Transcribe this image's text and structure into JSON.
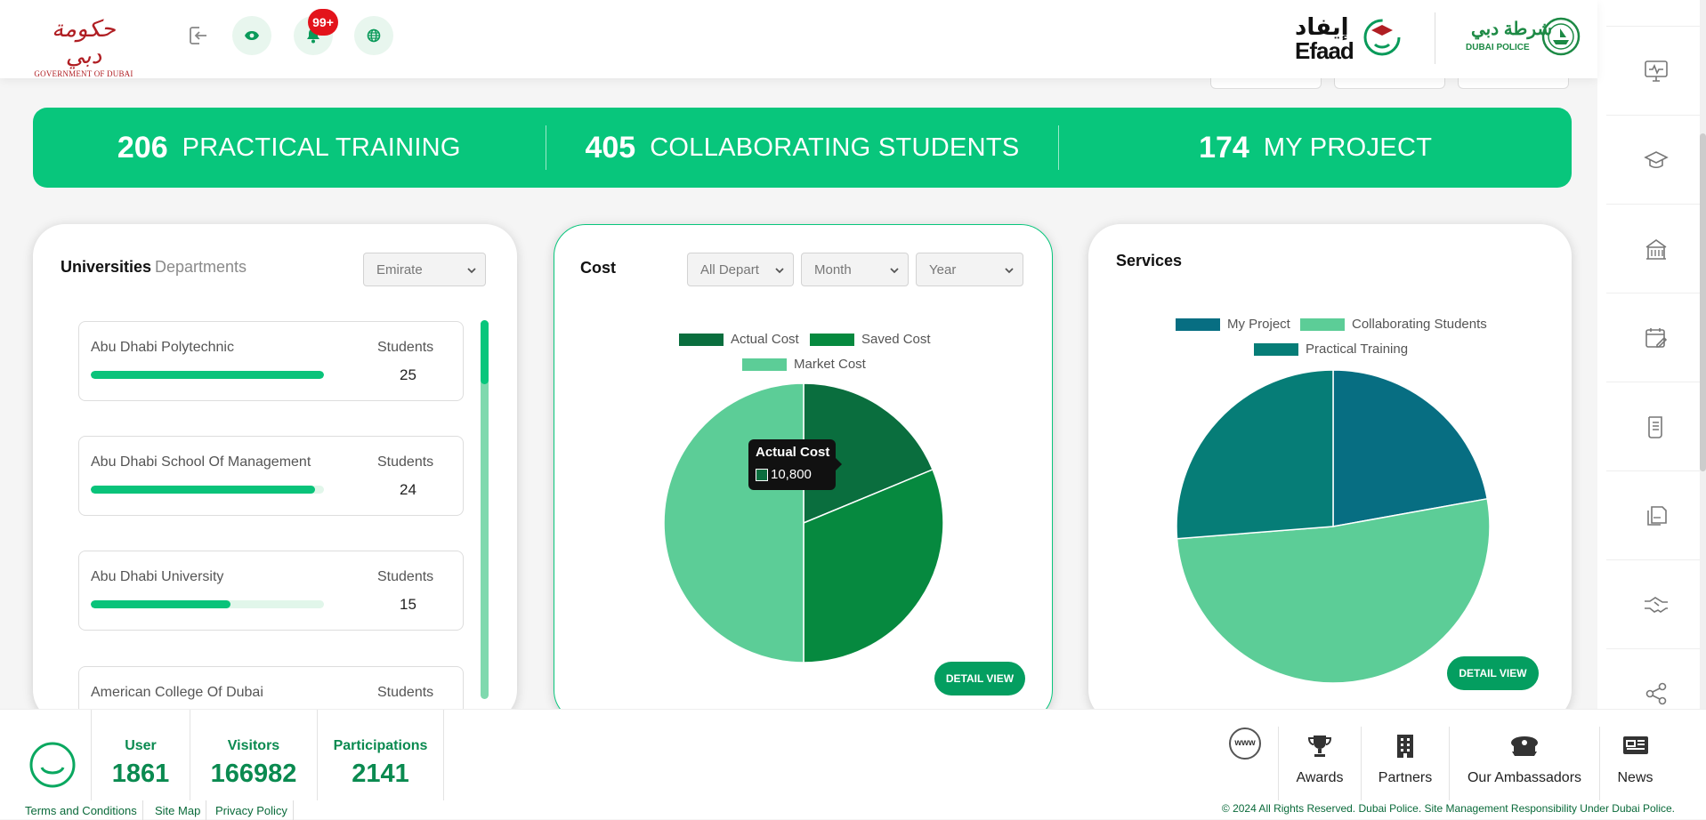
{
  "header": {
    "gov_logo_arabic": "حكومة دبي",
    "gov_logo_text": "GOVERNMENT OF DUBAI",
    "notification_badge": "99+",
    "efaad_arabic": "إيفاد",
    "efaad_text": "Efaad",
    "police_arabic": "شرطة دبي",
    "police_text": "DUBAI POLICE"
  },
  "stats": [
    {
      "value": "206",
      "label": "PRACTICAL TRAINING"
    },
    {
      "value": "405",
      "label": "COLLABORATING STUDENTS"
    },
    {
      "value": "174",
      "label": "MY PROJECT"
    }
  ],
  "universities_card": {
    "tab_active": "Universities",
    "tab_inactive": "Departments",
    "filter_selected": "Emirate",
    "items": [
      {
        "name": "Abu Dhabi Polytechnic",
        "label": "Students",
        "count": "25",
        "progress_pct": 100
      },
      {
        "name": "Abu Dhabi School Of Management",
        "label": "Students",
        "count": "24",
        "progress_pct": 96
      },
      {
        "name": "Abu Dhabi University",
        "label": "Students",
        "count": "15",
        "progress_pct": 60
      },
      {
        "name": "American College Of Dubai",
        "label": "Students",
        "count": "",
        "progress_pct": 0
      }
    ]
  },
  "cost_card": {
    "title": "Cost",
    "filters": [
      "All Depart",
      "Month",
      "Year"
    ],
    "legend": [
      "Actual Cost",
      "Saved Cost",
      "Market Cost"
    ],
    "tooltip_title": "Actual Cost",
    "tooltip_value": "10,800",
    "detail_label": "DETAIL VIEW",
    "colors": [
      "#0a6e3e",
      "#06893f",
      "#5ccd97"
    ]
  },
  "services_card": {
    "title": "Services",
    "legend": [
      "My Project",
      "Collaborating Students",
      "Practical Training"
    ],
    "detail_label": "DETAIL VIEW",
    "colors": [
      "#076e82",
      "#5ccd97",
      "#067d77"
    ]
  },
  "chart_data": [
    {
      "type": "pie",
      "title": "Cost",
      "labels": [
        "Actual Cost",
        "Saved Cost",
        "Market Cost"
      ],
      "values": [
        10800,
        18000,
        28800
      ],
      "colors": [
        "#0a6e3e",
        "#06893f",
        "#5ccd97"
      ]
    },
    {
      "type": "pie",
      "title": "Services",
      "labels": [
        "My Project",
        "Collaborating Students",
        "Practical Training"
      ],
      "values": [
        174,
        405,
        206
      ],
      "colors": [
        "#076e82",
        "#5ccd97",
        "#067d77"
      ]
    }
  ],
  "footer": {
    "stats": [
      {
        "label": "User",
        "value": "1861"
      },
      {
        "label": "Visitors",
        "value": "166982"
      },
      {
        "label": "Participations",
        "value": "2141"
      }
    ],
    "links": [
      "Terms and Conditions",
      "Site Map",
      "Privacy Policy"
    ],
    "www_label": "www",
    "nav": [
      "Awards",
      "Partners",
      "Our Ambassadors",
      "News"
    ],
    "copyright": "© 2024 All Rights Reserved. Dubai Police. Site Management Responsibility Under Dubai Police."
  }
}
